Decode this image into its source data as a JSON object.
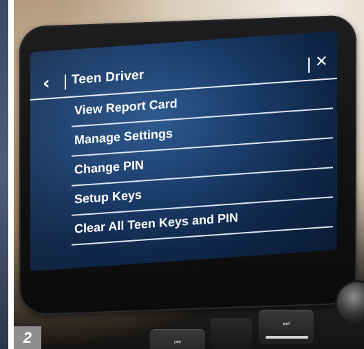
{
  "header": {
    "back_icon": "chevron-left-icon",
    "title": "Teen Driver",
    "close_icon": "close-icon"
  },
  "menu": {
    "items": [
      {
        "label": "View Report Card"
      },
      {
        "label": "Manage Settings"
      },
      {
        "label": "Change PIN"
      },
      {
        "label": "Setup Keys"
      },
      {
        "label": "Clear All Teen Keys and PIN"
      }
    ]
  },
  "hardware": {
    "prev_button": "⏮",
    "next_button": "⏭"
  },
  "figure": {
    "step_number": "2"
  },
  "colors": {
    "screen_blue": "#1c3f6e",
    "text": "#ffffff",
    "badge": "#8f8f8f"
  }
}
